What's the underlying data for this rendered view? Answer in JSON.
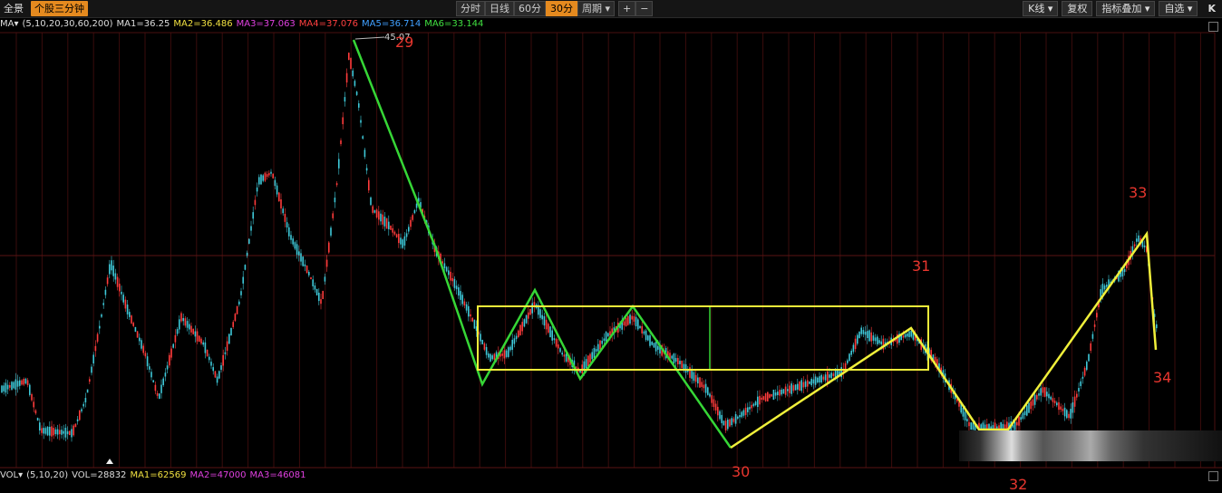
{
  "toolbar": {
    "left_label": "全景",
    "stock_btn": "个股三分钟",
    "periods": [
      "分时",
      "日线",
      "60分",
      "30分"
    ],
    "active_period": "30分",
    "cycle_label": "周期 ▾",
    "zoom_in": "+",
    "zoom_out": "−",
    "right_buttons": [
      "K线 ▾",
      "复权",
      "指标叠加 ▾",
      "自选 ▾"
    ],
    "close_icon": "K"
  },
  "ma_line": {
    "prefix": "MA▾",
    "params": "(5,10,20,30,60,200)",
    "ma1": "MA1=36.25",
    "ma2": "MA2=36.486",
    "ma3": "MA3=37.063",
    "ma4": "MA4=37.076",
    "ma5": "MA5=36.714",
    "ma6": "MA6=33.144"
  },
  "vol_line": {
    "prefix": "VOL▾",
    "params": "(5,10,20)",
    "vol": "VOL=28832",
    "ma1": "MA1=62569",
    "ma2": "MA2=47000",
    "ma3": "MA3=46081"
  },
  "high_price_label": "45.07",
  "wave_labels": {
    "w29": "29",
    "w30": "30",
    "w31": "31",
    "w32": "32",
    "w33": "33",
    "w34": "34"
  },
  "colors": {
    "up": "#ff3b3b",
    "down": "#3ec8d8",
    "green_line": "#36d636",
    "yellow_line": "#f0f03a",
    "label_red": "#e8362e",
    "orange_btn": "#e58a1f"
  }
}
